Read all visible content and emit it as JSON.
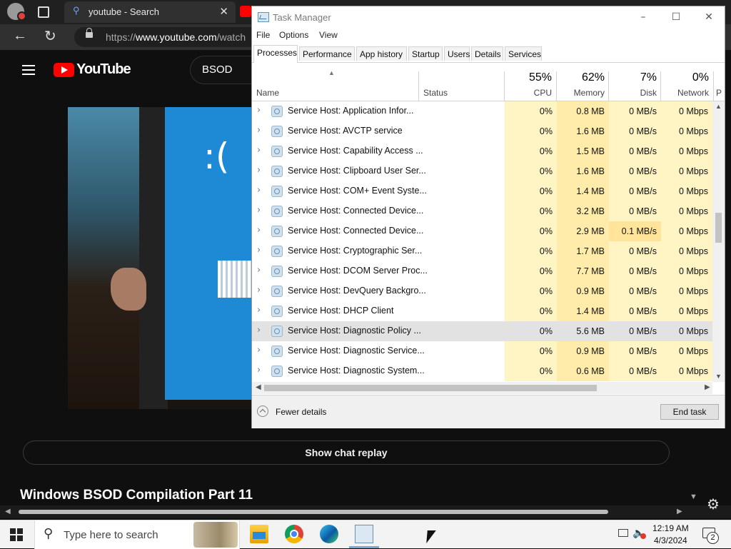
{
  "browser": {
    "tab_title": "youtube - Search",
    "url_prefix": "https://",
    "url_domain": "www.youtube.com",
    "url_rest": "/watch"
  },
  "youtube": {
    "logo_text": "YouTube",
    "search_value": "BSOD",
    "video_sad_face": ":(",
    "chat_replay_label": "Show chat replay",
    "video_title": "Windows BSOD Compilation Part 11"
  },
  "task_manager": {
    "title": "Task Manager",
    "menu": [
      "File",
      "Options",
      "View"
    ],
    "tabs": [
      "Processes",
      "Performance",
      "App history",
      "Startup",
      "Users",
      "Details",
      "Services"
    ],
    "active_tab": "Processes",
    "columns": {
      "name": "Name",
      "status": "Status",
      "cpu": {
        "pct": "55%",
        "label": "CPU"
      },
      "memory": {
        "pct": "62%",
        "label": "Memory"
      },
      "disk": {
        "pct": "7%",
        "label": "Disk"
      },
      "network": {
        "pct": "0%",
        "label": "Network"
      },
      "power_partial": "P"
    },
    "processes": [
      {
        "name": "Service Host: Application Infor...",
        "cpu": "0%",
        "memory": "0.8 MB",
        "disk": "0 MB/s",
        "network": "0 Mbps"
      },
      {
        "name": "Service Host: AVCTP service",
        "cpu": "0%",
        "memory": "1.6 MB",
        "disk": "0 MB/s",
        "network": "0 Mbps"
      },
      {
        "name": "Service Host: Capability Access ...",
        "cpu": "0%",
        "memory": "1.5 MB",
        "disk": "0 MB/s",
        "network": "0 Mbps"
      },
      {
        "name": "Service Host: Clipboard User Ser...",
        "cpu": "0%",
        "memory": "1.6 MB",
        "disk": "0 MB/s",
        "network": "0 Mbps"
      },
      {
        "name": "Service Host: COM+ Event Syste...",
        "cpu": "0%",
        "memory": "1.4 MB",
        "disk": "0 MB/s",
        "network": "0 Mbps"
      },
      {
        "name": "Service Host: Connected Device...",
        "cpu": "0%",
        "memory": "3.2 MB",
        "disk": "0 MB/s",
        "network": "0 Mbps"
      },
      {
        "name": "Service Host: Connected Device...",
        "cpu": "0%",
        "memory": "2.9 MB",
        "disk": "0.1 MB/s",
        "network": "0 Mbps"
      },
      {
        "name": "Service Host: Cryptographic Ser...",
        "cpu": "0%",
        "memory": "1.7 MB",
        "disk": "0 MB/s",
        "network": "0 Mbps"
      },
      {
        "name": "Service Host: DCOM Server Proc...",
        "cpu": "0%",
        "memory": "7.7 MB",
        "disk": "0 MB/s",
        "network": "0 Mbps"
      },
      {
        "name": "Service Host: DevQuery Backgro...",
        "cpu": "0%",
        "memory": "0.9 MB",
        "disk": "0 MB/s",
        "network": "0 Mbps"
      },
      {
        "name": "Service Host: DHCP Client",
        "cpu": "0%",
        "memory": "1.4 MB",
        "disk": "0 MB/s",
        "network": "0 Mbps"
      },
      {
        "name": "Service Host: Diagnostic Policy ...",
        "cpu": "0%",
        "memory": "5.6 MB",
        "disk": "0 MB/s",
        "network": "0 Mbps"
      },
      {
        "name": "Service Host: Diagnostic Service...",
        "cpu": "0%",
        "memory": "0.9 MB",
        "disk": "0 MB/s",
        "network": "0 Mbps"
      },
      {
        "name": "Service Host: Diagnostic System...",
        "cpu": "0%",
        "memory": "0.6 MB",
        "disk": "0 MB/s",
        "network": "0 Mbps"
      }
    ],
    "selected_process": "Service Host: Diagnostic Policy ...",
    "fewer_details_label": "Fewer details",
    "end_task_label": "End task"
  },
  "taskbar": {
    "search_placeholder": "Type here to search",
    "apps": [
      "file-explorer-icon",
      "chrome-icon",
      "edge-icon",
      "task-manager-icon"
    ],
    "time": "12:19 AM",
    "date": "4/3/2024",
    "notification_count": "2"
  }
}
